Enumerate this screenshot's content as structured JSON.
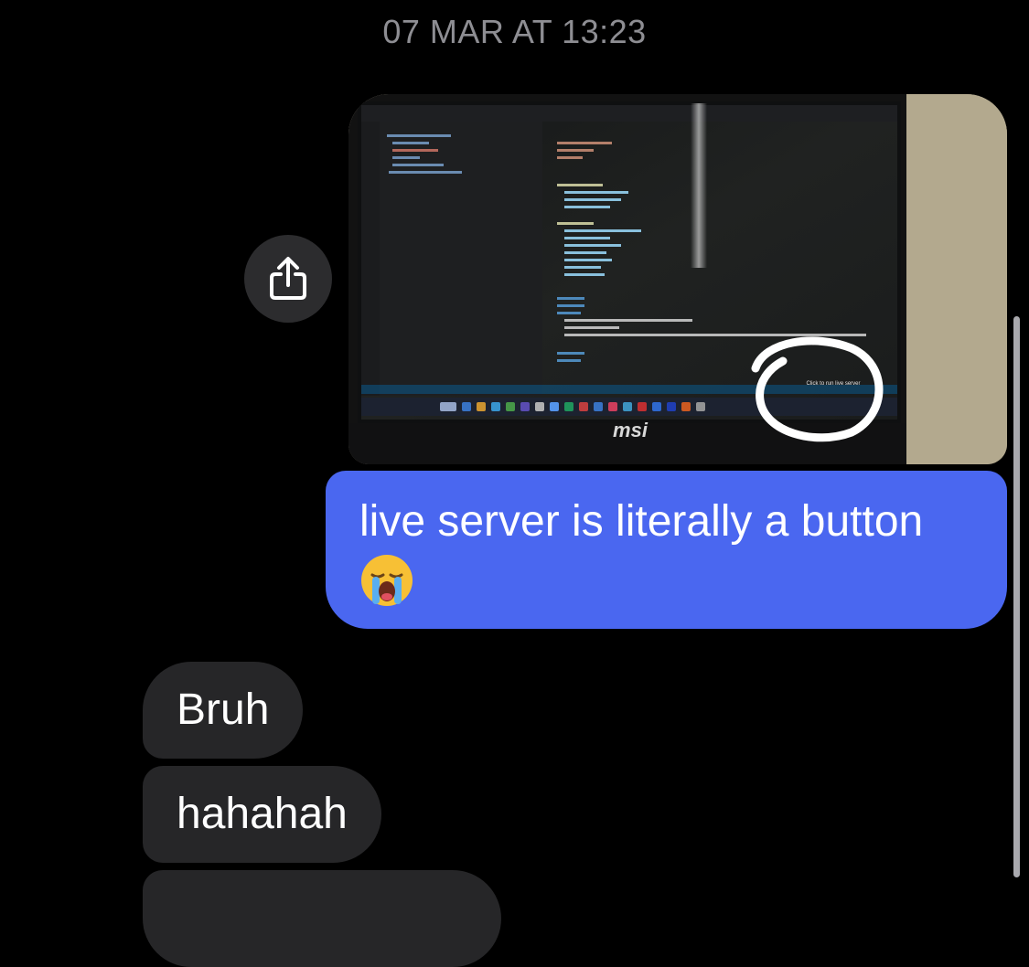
{
  "conversation": {
    "timestamp": "07 MAR AT 13:23",
    "photo_message": {
      "laptop_brand": "msi",
      "overlay": "Click to run live server"
    },
    "sent_message": {
      "line1": "live server is literally a button",
      "emoji": "loudly-crying-face"
    },
    "received_messages": [
      {
        "text": "Bruh"
      },
      {
        "text": "hahahah"
      },
      {
        "text": ""
      }
    ]
  },
  "icons": {
    "share": "share-icon"
  },
  "colors": {
    "background": "#000000",
    "sent_bubble": "#4a67f0",
    "received_bubble": "#262628",
    "timestamp": "#8e8e93"
  }
}
